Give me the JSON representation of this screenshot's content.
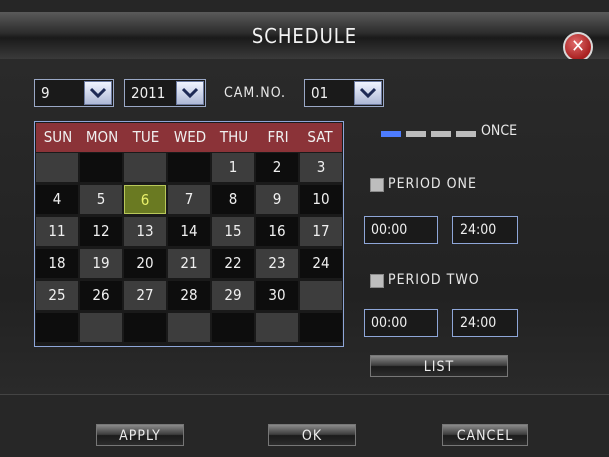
{
  "title": "SCHEDULE",
  "selects": {
    "month": "9",
    "year": "2011",
    "cam_label": "CAM.NO.",
    "cam": "01"
  },
  "calendar": {
    "weekdays": [
      "SUN",
      "MON",
      "TUE",
      "WED",
      "THU",
      "FRI",
      "SAT"
    ],
    "weeks": [
      [
        "",
        "",
        "",
        "",
        "1",
        "2",
        "3"
      ],
      [
        "4",
        "5",
        "6",
        "7",
        "8",
        "9",
        "10"
      ],
      [
        "11",
        "12",
        "13",
        "14",
        "15",
        "16",
        "17"
      ],
      [
        "18",
        "19",
        "20",
        "21",
        "22",
        "23",
        "24"
      ],
      [
        "25",
        "26",
        "27",
        "28",
        "29",
        "30",
        ""
      ],
      [
        "",
        "",
        "",
        "",
        "",
        "",
        ""
      ]
    ],
    "selected_day": "6"
  },
  "legend": {
    "label": "ONCE",
    "active_color": "#4d7cff",
    "inactive_color": "#bcbcbc"
  },
  "period_one": {
    "label": "PERIOD  ONE",
    "start": "00:00",
    "end": "24:00"
  },
  "period_two": {
    "label": "PERIOD  TWO",
    "start": "00:00",
    "end": "24:00"
  },
  "buttons": {
    "list": "LIST",
    "apply": "APPLY",
    "ok": "OK",
    "cancel": "CANCEL"
  },
  "icons": {
    "close": "close-icon",
    "dropdown": "chevron-down-icon"
  },
  "colors": {
    "weekday_header": "#8b3338",
    "selected_day": "#6a7a22",
    "border_accent": "#8ea6d8"
  }
}
